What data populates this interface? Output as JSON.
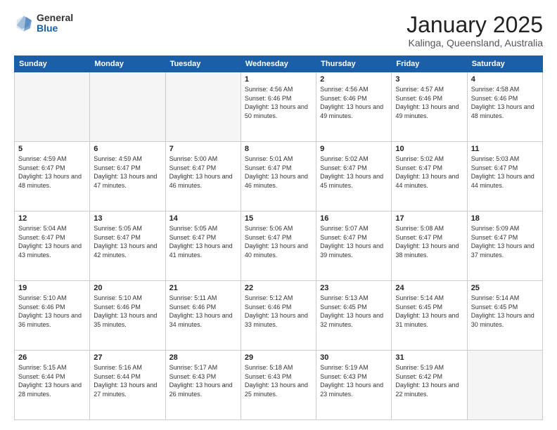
{
  "logo": {
    "general": "General",
    "blue": "Blue"
  },
  "header": {
    "month": "January 2025",
    "location": "Kalinga, Queensland, Australia"
  },
  "weekdays": [
    "Sunday",
    "Monday",
    "Tuesday",
    "Wednesday",
    "Thursday",
    "Friday",
    "Saturday"
  ],
  "weeks": [
    [
      {
        "day": "",
        "empty": true
      },
      {
        "day": "",
        "empty": true
      },
      {
        "day": "",
        "empty": true
      },
      {
        "day": "1",
        "sunrise": "Sunrise: 4:56 AM",
        "sunset": "Sunset: 6:46 PM",
        "daylight": "Daylight: 13 hours and 50 minutes."
      },
      {
        "day": "2",
        "sunrise": "Sunrise: 4:56 AM",
        "sunset": "Sunset: 6:46 PM",
        "daylight": "Daylight: 13 hours and 49 minutes."
      },
      {
        "day": "3",
        "sunrise": "Sunrise: 4:57 AM",
        "sunset": "Sunset: 6:46 PM",
        "daylight": "Daylight: 13 hours and 49 minutes."
      },
      {
        "day": "4",
        "sunrise": "Sunrise: 4:58 AM",
        "sunset": "Sunset: 6:46 PM",
        "daylight": "Daylight: 13 hours and 48 minutes."
      }
    ],
    [
      {
        "day": "5",
        "sunrise": "Sunrise: 4:59 AM",
        "sunset": "Sunset: 6:47 PM",
        "daylight": "Daylight: 13 hours and 48 minutes."
      },
      {
        "day": "6",
        "sunrise": "Sunrise: 4:59 AM",
        "sunset": "Sunset: 6:47 PM",
        "daylight": "Daylight: 13 hours and 47 minutes."
      },
      {
        "day": "7",
        "sunrise": "Sunrise: 5:00 AM",
        "sunset": "Sunset: 6:47 PM",
        "daylight": "Daylight: 13 hours and 46 minutes."
      },
      {
        "day": "8",
        "sunrise": "Sunrise: 5:01 AM",
        "sunset": "Sunset: 6:47 PM",
        "daylight": "Daylight: 13 hours and 46 minutes."
      },
      {
        "day": "9",
        "sunrise": "Sunrise: 5:02 AM",
        "sunset": "Sunset: 6:47 PM",
        "daylight": "Daylight: 13 hours and 45 minutes."
      },
      {
        "day": "10",
        "sunrise": "Sunrise: 5:02 AM",
        "sunset": "Sunset: 6:47 PM",
        "daylight": "Daylight: 13 hours and 44 minutes."
      },
      {
        "day": "11",
        "sunrise": "Sunrise: 5:03 AM",
        "sunset": "Sunset: 6:47 PM",
        "daylight": "Daylight: 13 hours and 44 minutes."
      }
    ],
    [
      {
        "day": "12",
        "sunrise": "Sunrise: 5:04 AM",
        "sunset": "Sunset: 6:47 PM",
        "daylight": "Daylight: 13 hours and 43 minutes."
      },
      {
        "day": "13",
        "sunrise": "Sunrise: 5:05 AM",
        "sunset": "Sunset: 6:47 PM",
        "daylight": "Daylight: 13 hours and 42 minutes."
      },
      {
        "day": "14",
        "sunrise": "Sunrise: 5:05 AM",
        "sunset": "Sunset: 6:47 PM",
        "daylight": "Daylight: 13 hours and 41 minutes."
      },
      {
        "day": "15",
        "sunrise": "Sunrise: 5:06 AM",
        "sunset": "Sunset: 6:47 PM",
        "daylight": "Daylight: 13 hours and 40 minutes."
      },
      {
        "day": "16",
        "sunrise": "Sunrise: 5:07 AM",
        "sunset": "Sunset: 6:47 PM",
        "daylight": "Daylight: 13 hours and 39 minutes."
      },
      {
        "day": "17",
        "sunrise": "Sunrise: 5:08 AM",
        "sunset": "Sunset: 6:47 PM",
        "daylight": "Daylight: 13 hours and 38 minutes."
      },
      {
        "day": "18",
        "sunrise": "Sunrise: 5:09 AM",
        "sunset": "Sunset: 6:47 PM",
        "daylight": "Daylight: 13 hours and 37 minutes."
      }
    ],
    [
      {
        "day": "19",
        "sunrise": "Sunrise: 5:10 AM",
        "sunset": "Sunset: 6:46 PM",
        "daylight": "Daylight: 13 hours and 36 minutes."
      },
      {
        "day": "20",
        "sunrise": "Sunrise: 5:10 AM",
        "sunset": "Sunset: 6:46 PM",
        "daylight": "Daylight: 13 hours and 35 minutes."
      },
      {
        "day": "21",
        "sunrise": "Sunrise: 5:11 AM",
        "sunset": "Sunset: 6:46 PM",
        "daylight": "Daylight: 13 hours and 34 minutes."
      },
      {
        "day": "22",
        "sunrise": "Sunrise: 5:12 AM",
        "sunset": "Sunset: 6:46 PM",
        "daylight": "Daylight: 13 hours and 33 minutes."
      },
      {
        "day": "23",
        "sunrise": "Sunrise: 5:13 AM",
        "sunset": "Sunset: 6:45 PM",
        "daylight": "Daylight: 13 hours and 32 minutes."
      },
      {
        "day": "24",
        "sunrise": "Sunrise: 5:14 AM",
        "sunset": "Sunset: 6:45 PM",
        "daylight": "Daylight: 13 hours and 31 minutes."
      },
      {
        "day": "25",
        "sunrise": "Sunrise: 5:14 AM",
        "sunset": "Sunset: 6:45 PM",
        "daylight": "Daylight: 13 hours and 30 minutes."
      }
    ],
    [
      {
        "day": "26",
        "sunrise": "Sunrise: 5:15 AM",
        "sunset": "Sunset: 6:44 PM",
        "daylight": "Daylight: 13 hours and 28 minutes."
      },
      {
        "day": "27",
        "sunrise": "Sunrise: 5:16 AM",
        "sunset": "Sunset: 6:44 PM",
        "daylight": "Daylight: 13 hours and 27 minutes."
      },
      {
        "day": "28",
        "sunrise": "Sunrise: 5:17 AM",
        "sunset": "Sunset: 6:43 PM",
        "daylight": "Daylight: 13 hours and 26 minutes."
      },
      {
        "day": "29",
        "sunrise": "Sunrise: 5:18 AM",
        "sunset": "Sunset: 6:43 PM",
        "daylight": "Daylight: 13 hours and 25 minutes."
      },
      {
        "day": "30",
        "sunrise": "Sunrise: 5:19 AM",
        "sunset": "Sunset: 6:43 PM",
        "daylight": "Daylight: 13 hours and 23 minutes."
      },
      {
        "day": "31",
        "sunrise": "Sunrise: 5:19 AM",
        "sunset": "Sunset: 6:42 PM",
        "daylight": "Daylight: 13 hours and 22 minutes."
      },
      {
        "day": "",
        "empty": true
      }
    ]
  ]
}
